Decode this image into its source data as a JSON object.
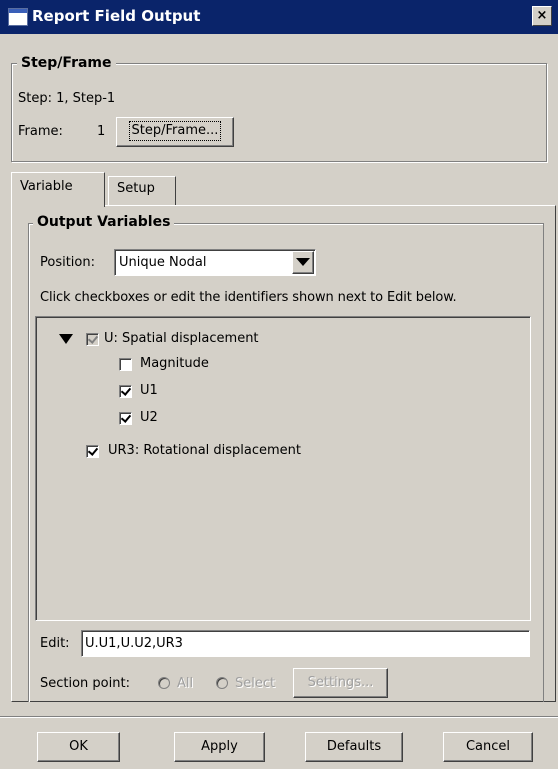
{
  "window": {
    "title": "Report Field Output",
    "close_label": "×"
  },
  "step_frame": {
    "legend": "Step/Frame",
    "step_text": "Step: 1, Step-1",
    "frame_label": "Frame:",
    "frame_value": "1",
    "button_label": "Step/Frame..."
  },
  "tabs": [
    {
      "label": "Variable",
      "active": true
    },
    {
      "label": "Setup",
      "active": false
    }
  ],
  "output_variables": {
    "legend": "Output Variables",
    "position_label": "Position:",
    "position_value": "Unique Nodal",
    "instructions": "Click checkboxes or edit the identifiers shown next to Edit below.",
    "tree": {
      "u_label": "U: Spatial displacement",
      "magnitude_label": "Magnitude",
      "u1_label": "U1",
      "u2_label": "U2",
      "ur3_label": "UR3: Rotational displacement"
    },
    "edit_label": "Edit:",
    "edit_value": "U.U1,U.U2,UR3",
    "section_point_label": "Section point:",
    "section_all": "All",
    "section_select": "Select",
    "settings_button": "Settings..."
  },
  "buttons": {
    "ok": "OK",
    "apply": "Apply",
    "defaults": "Defaults",
    "cancel": "Cancel"
  }
}
